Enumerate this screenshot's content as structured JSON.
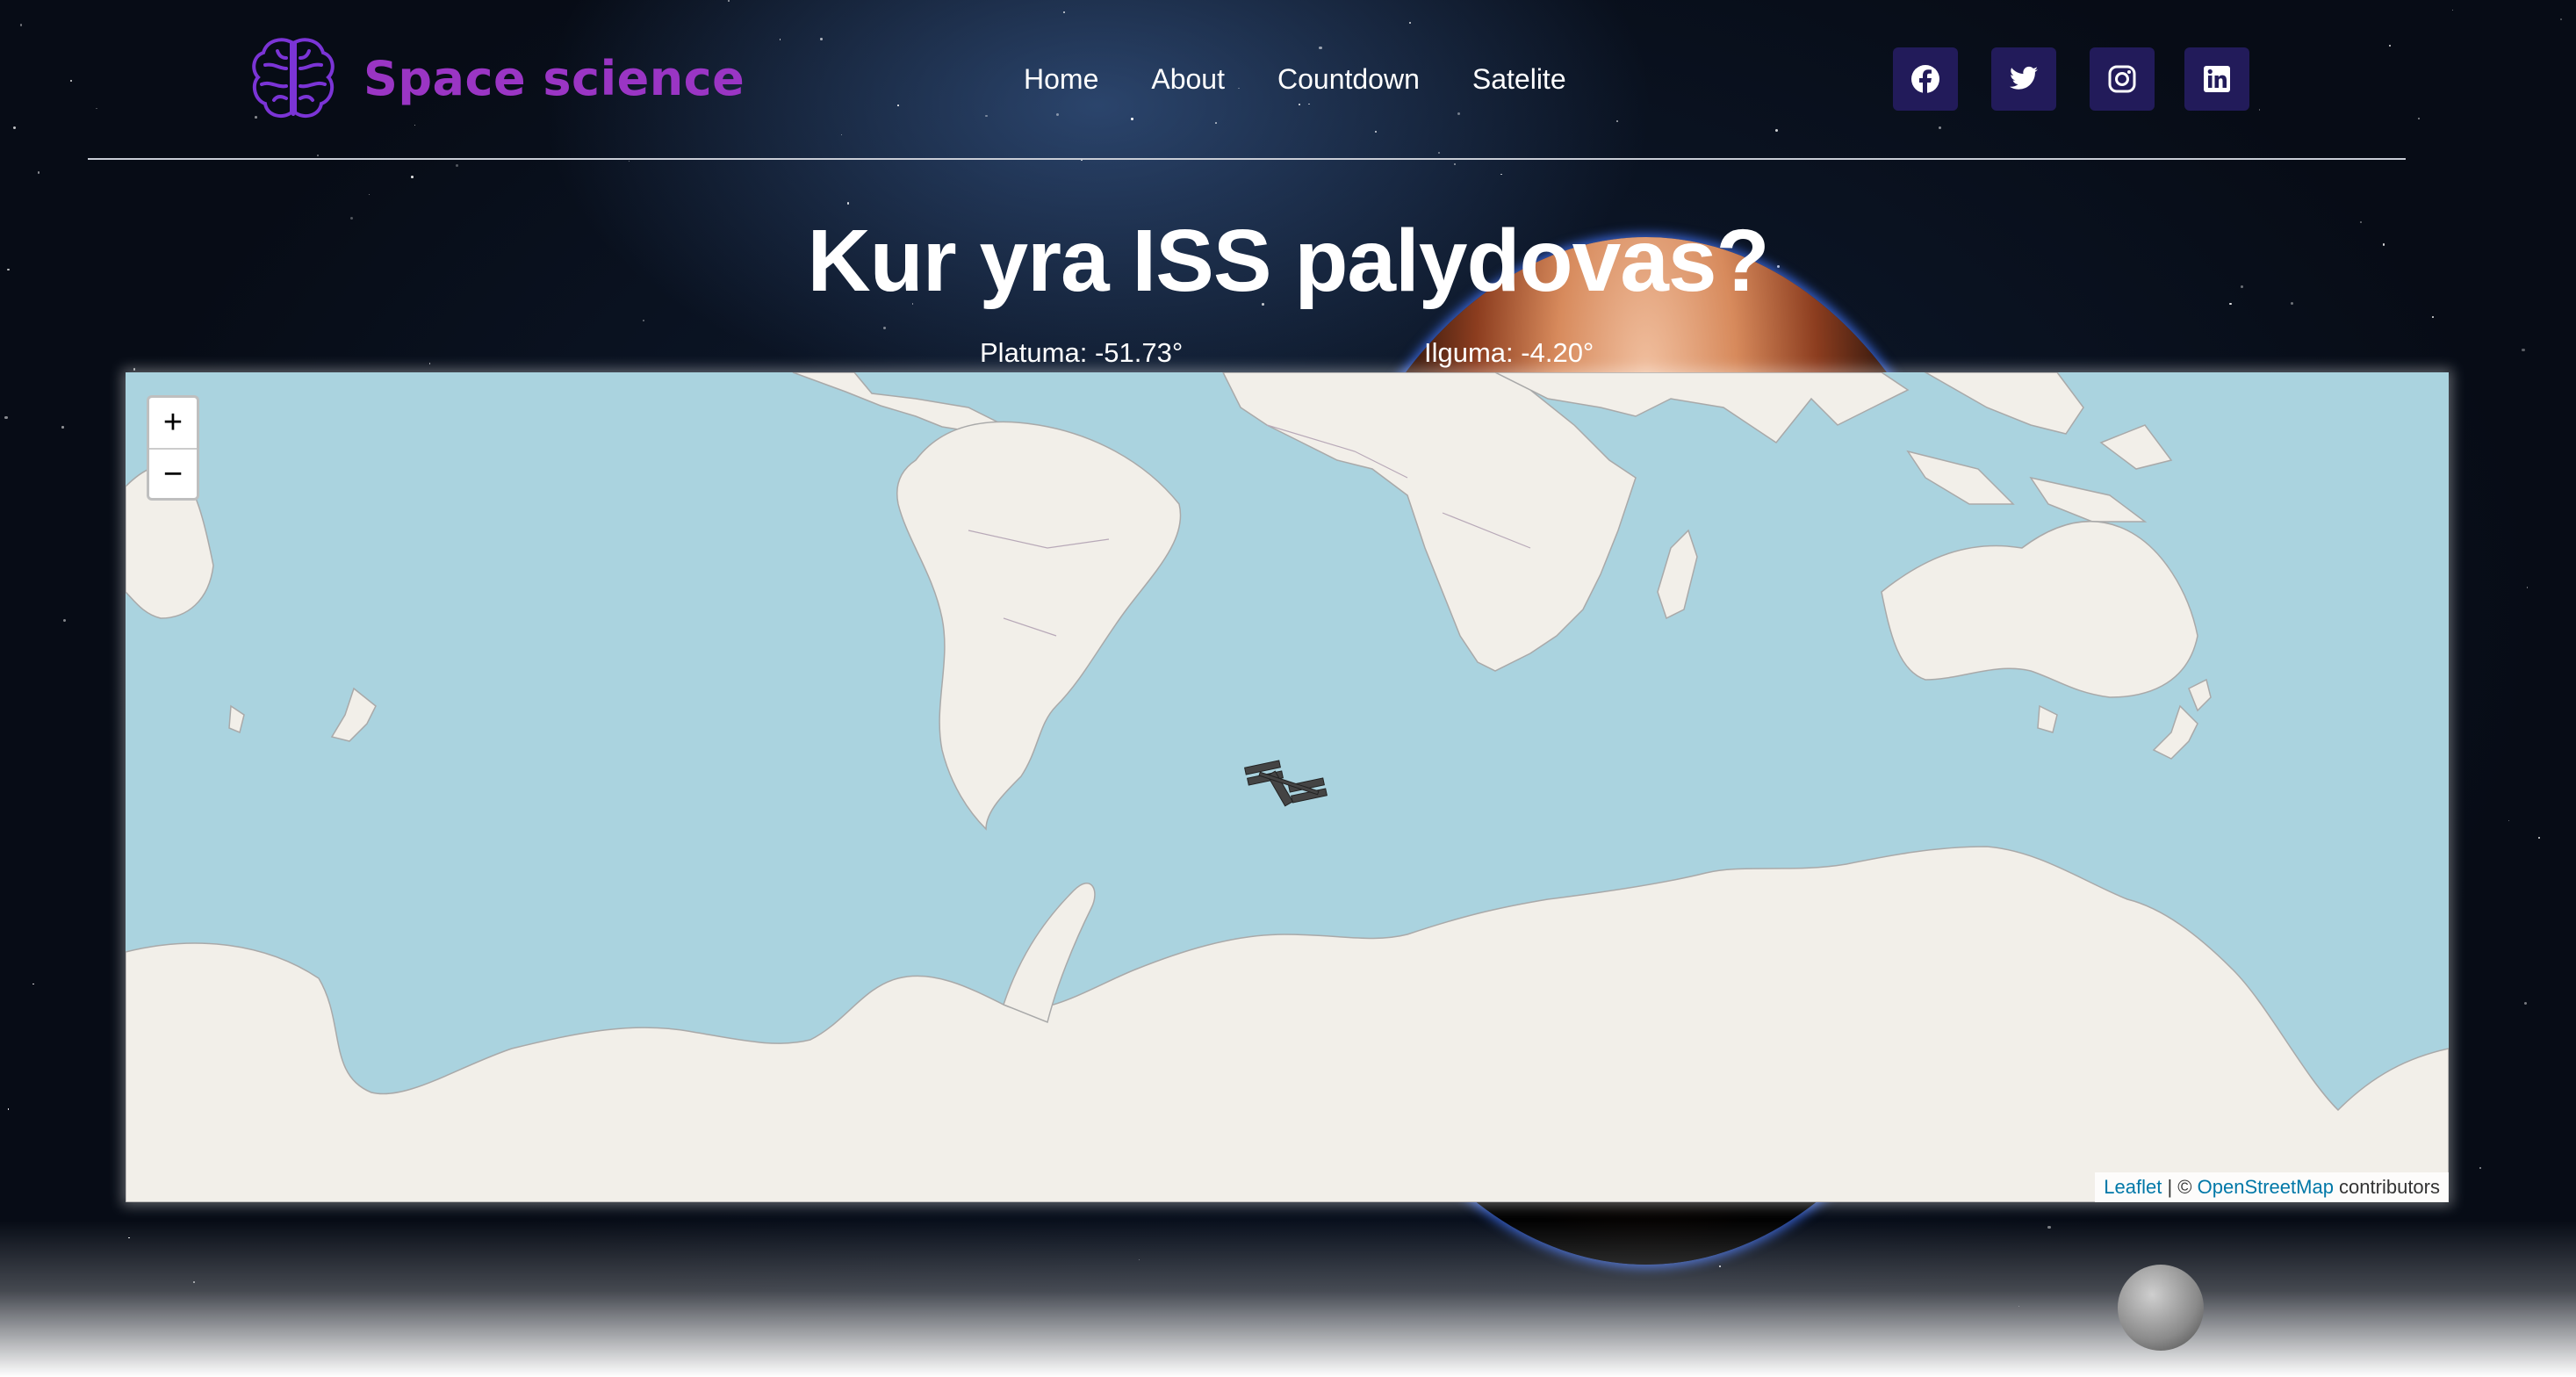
{
  "brand": {
    "name": "Space science",
    "logo_icon": "brain-icon",
    "accent": "#9a35c4"
  },
  "nav": {
    "items": [
      "Home",
      "About",
      "Countdown",
      "Satelite"
    ]
  },
  "social": [
    {
      "icon": "facebook-icon"
    },
    {
      "icon": "twitter-icon"
    },
    {
      "icon": "instagram-icon"
    },
    {
      "icon": "linkedin-icon"
    }
  ],
  "page": {
    "title": "Kur yra ISS palydovas?",
    "latitude_text": "Platuma: -51.73°",
    "longitude_text": "Ilguma: -4.20°"
  },
  "map": {
    "zoom_in_label": "+",
    "zoom_out_label": "−",
    "marker_icon": "iss-satellite-icon",
    "attribution": {
      "leaflet": "Leaflet",
      "separator": " | © ",
      "osm": "OpenStreetMap",
      "suffix": " contributors"
    },
    "colors": {
      "water": "#aad3df",
      "land": "#f2efe9",
      "borders": "#9e9e9e"
    }
  }
}
